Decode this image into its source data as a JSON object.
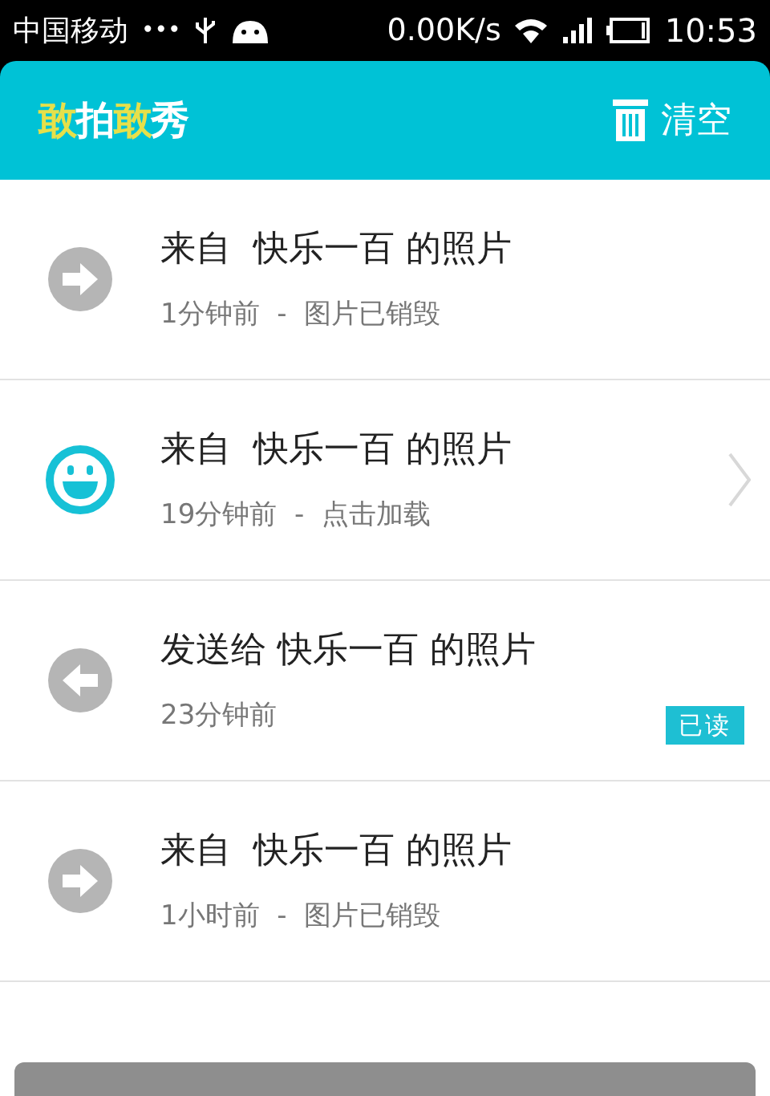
{
  "status_bar": {
    "carrier": "中国移动",
    "dots": "•••",
    "speed": "0.00K/s",
    "time": "10:53"
  },
  "header": {
    "logo": [
      {
        "text": "敢",
        "color": "#e6e04a"
      },
      {
        "text": "拍",
        "color": "#ffffff"
      },
      {
        "text": "敢",
        "color": "#e6e04a"
      },
      {
        "text": "秀",
        "color": "#ffffff"
      }
    ],
    "clear_label": "清空"
  },
  "messages": [
    {
      "kind": "incoming",
      "title": "来自  快乐一百 的照片",
      "subtitle": "1分钟前  -  图片已销毁",
      "chevron": false
    },
    {
      "kind": "new",
      "title": "来自  快乐一百 的照片",
      "subtitle": "19分钟前  -  点击加载",
      "chevron": true
    },
    {
      "kind": "outgoing",
      "title": "发送给 快乐一百 的照片",
      "subtitle": "23分钟前",
      "chevron": false,
      "badge": "已读"
    },
    {
      "kind": "incoming",
      "title": "来自  快乐一百 的照片",
      "subtitle": "1小时前  -  图片已销毁",
      "chevron": false
    }
  ]
}
